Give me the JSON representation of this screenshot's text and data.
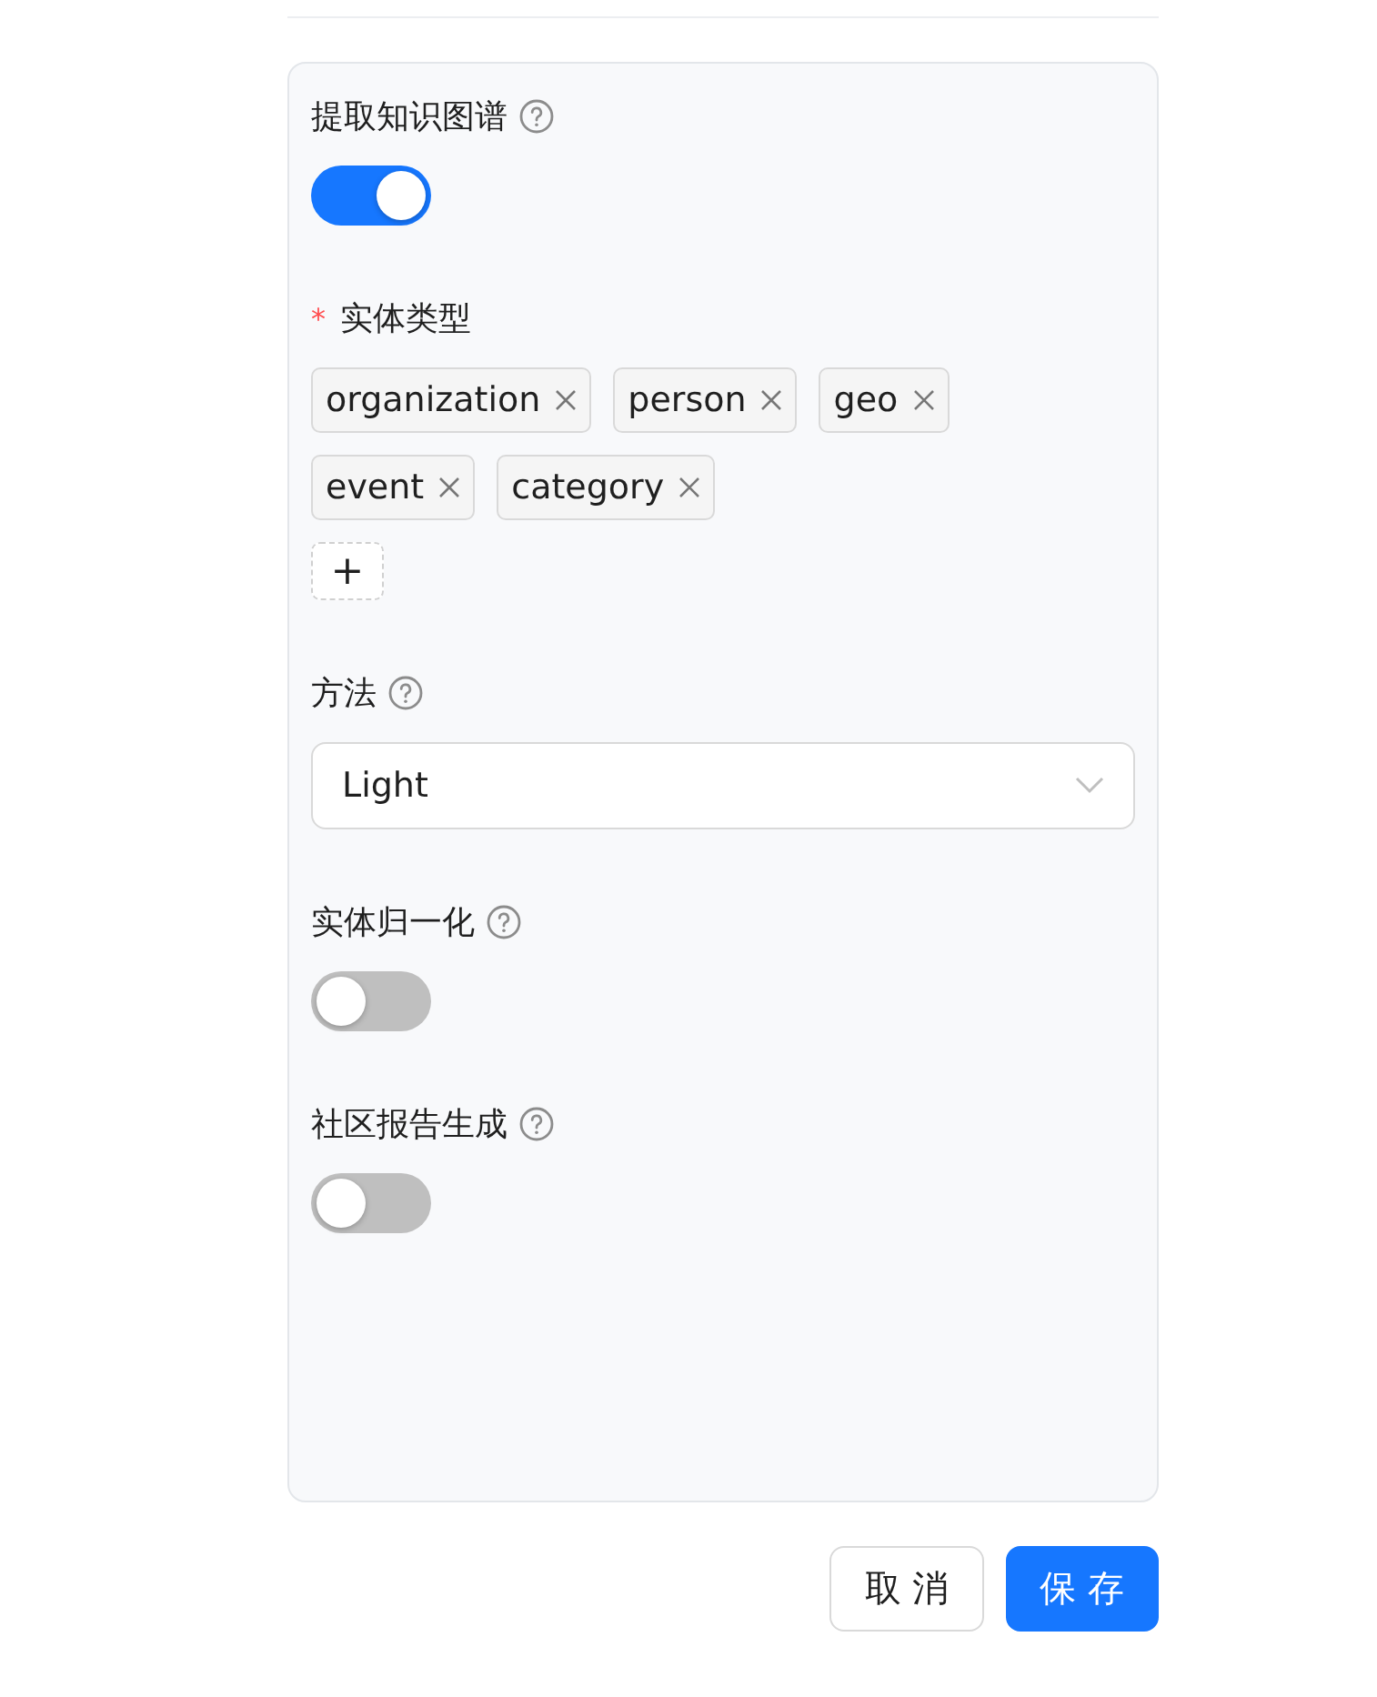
{
  "fields": [
    {
      "kind": "switch",
      "label": "提取知识图谱",
      "help": true,
      "on": true
    },
    {
      "kind": "tags",
      "label": "实体类型",
      "required_mark": "*",
      "tags": [
        "organization",
        "person",
        "geo",
        "event",
        "category"
      ],
      "add": "+"
    },
    {
      "kind": "select",
      "label": "方法",
      "help": true,
      "value": "Light"
    },
    {
      "kind": "switch",
      "label": "实体归一化",
      "help": true,
      "on": false
    },
    {
      "kind": "switch",
      "label": "社区报告生成",
      "help": true,
      "on": false
    }
  ],
  "buttons": [
    {
      "label": "取 消",
      "primary": false
    },
    {
      "label": "保 存",
      "primary": true
    }
  ]
}
